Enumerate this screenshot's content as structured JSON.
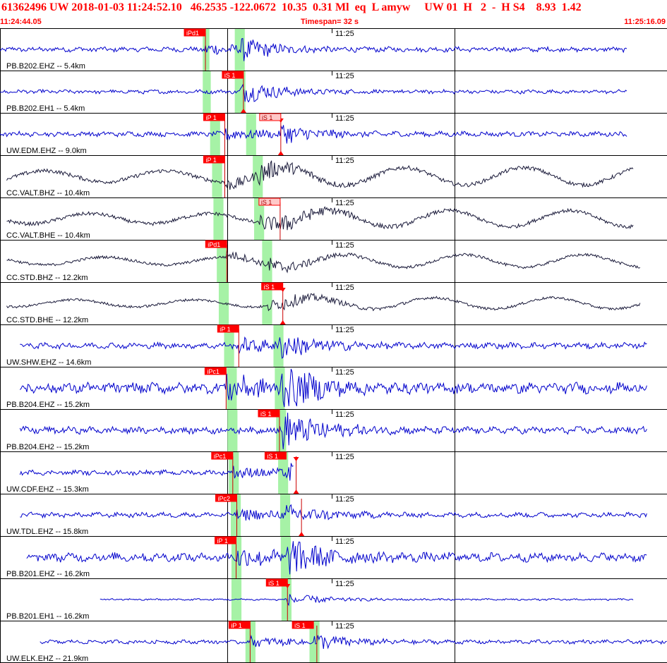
{
  "header": {
    "title": "61362496 UW 2018-01-03 11:24:52.10   46.2535 -122.0672  10.35  0.31 Ml  eq  L amyw     UW 01  H   2  -  H S4    8.93  1.42",
    "start_time": "11:24:44.05",
    "timespan": "Timespan=  32 s",
    "end_time": "11:25:16.09"
  },
  "colors": {
    "header_text": "#ff0000",
    "trace_blue": "#0000cc",
    "trace_black": "#1a1a3a",
    "pick_box": "#ff0000",
    "pick_box_light": "#ffc8c8",
    "pick_line": "#cc0000",
    "window_band": "#a6f2a6",
    "grid": "#000000"
  },
  "minute_label": "11:25",
  "traces": [
    {
      "label": "PB.B202.EHZ -- 5.4km",
      "color": "blue",
      "amp": 5,
      "lowfreq": false,
      "start": 0.0,
      "end": 0.94,
      "picks": [
        {
          "text": "iPd1",
          "pos": 0.308,
          "light": false
        }
      ],
      "bands": [
        {
          "a": 0.304,
          "b": 0.314
        },
        {
          "a": 0.352,
          "b": 0.367
        }
      ],
      "lines": [
        {
          "pos": 0.308,
          "top": false,
          "bottom": false
        }
      ]
    },
    {
      "label": "PB.B202.EH1 -- 5.4km",
      "color": "blue",
      "amp": 4,
      "lowfreq": false,
      "start": 0.0,
      "end": 0.94,
      "picks": [
        {
          "text": "iS 1",
          "pos": 0.365,
          "light": false
        }
      ],
      "bands": [
        {
          "a": 0.304,
          "b": 0.316
        },
        {
          "a": 0.352,
          "b": 0.368
        }
      ],
      "lines": [
        {
          "pos": 0.365,
          "top": false,
          "bottom": true
        }
      ]
    },
    {
      "label": "UW.EDM.EHZ -- 9.0km",
      "color": "blue",
      "amp": 5,
      "lowfreq": false,
      "start": 0.0,
      "end": 0.94,
      "picks": [
        {
          "text": "iP 1",
          "pos": 0.337,
          "light": false
        },
        {
          "text": "iS 1",
          "pos": 0.421,
          "light": true
        }
      ],
      "bands": [
        {
          "a": 0.315,
          "b": 0.33
        },
        {
          "a": 0.369,
          "b": 0.384
        }
      ],
      "lines": [
        {
          "pos": 0.337,
          "top": false,
          "bottom": false
        },
        {
          "pos": 0.421,
          "top": true,
          "bottom": true
        }
      ]
    },
    {
      "label": "CC.VALT.BHZ -- 10.4km",
      "color": "black",
      "amp": 14,
      "lowfreq": true,
      "start": 0.01,
      "end": 0.95,
      "picks": [
        {
          "text": "iP 1",
          "pos": 0.337,
          "light": false
        }
      ],
      "bands": [
        {
          "a": 0.318,
          "b": 0.333
        },
        {
          "a": 0.379,
          "b": 0.394
        }
      ],
      "lines": [
        {
          "pos": 0.337,
          "top": false,
          "bottom": false
        }
      ]
    },
    {
      "label": "CC.VALT.BHE -- 10.4km",
      "color": "black",
      "amp": 13,
      "lowfreq": true,
      "start": 0.01,
      "end": 0.95,
      "picks": [
        {
          "text": "iS 1",
          "pos": 0.42,
          "light": true
        }
      ],
      "bands": [
        {
          "a": 0.32,
          "b": 0.335
        },
        {
          "a": 0.381,
          "b": 0.396
        }
      ],
      "lines": [
        {
          "pos": 0.42,
          "top": false,
          "bottom": false
        }
      ]
    },
    {
      "label": "CC.STD.BHZ -- 12.2km",
      "color": "black",
      "amp": 10,
      "lowfreq": true,
      "start": 0.01,
      "end": 0.96,
      "picks": [
        {
          "text": "iPd1",
          "pos": 0.34,
          "light": false
        }
      ],
      "bands": [
        {
          "a": 0.325,
          "b": 0.34
        },
        {
          "a": 0.393,
          "b": 0.408
        }
      ],
      "lines": [
        {
          "pos": 0.34,
          "top": false,
          "bottom": false
        }
      ]
    },
    {
      "label": "CC.STD.BHE -- 12.2km",
      "color": "black",
      "amp": 9,
      "lowfreq": true,
      "start": 0.01,
      "end": 0.96,
      "picks": [
        {
          "text": "iS 1",
          "pos": 0.424,
          "light": false
        }
      ],
      "bands": [
        {
          "a": 0.328,
          "b": 0.343
        },
        {
          "a": 0.393,
          "b": 0.408
        }
      ],
      "lines": [
        {
          "pos": 0.424,
          "top": true,
          "bottom": true
        }
      ]
    },
    {
      "label": "UW.SHW.EHZ -- 14.6km",
      "color": "blue",
      "amp": 6,
      "lowfreq": false,
      "start": 0.03,
      "end": 0.97,
      "picks": [
        {
          "text": "iP 1",
          "pos": 0.358,
          "light": false
        }
      ],
      "bands": [
        {
          "a": 0.336,
          "b": 0.351
        },
        {
          "a": 0.41,
          "b": 0.425
        }
      ],
      "lines": [
        {
          "pos": 0.358,
          "top": false,
          "bottom": false
        }
      ]
    },
    {
      "label": "PB.B204.EHZ -- 15.2km",
      "color": "blue",
      "amp": 11,
      "lowfreq": false,
      "start": 0.03,
      "end": 0.97,
      "picks": [
        {
          "text": "iPc1",
          "pos": 0.339,
          "light": false
        }
      ],
      "bands": [
        {
          "a": 0.34,
          "b": 0.355
        },
        {
          "a": 0.412,
          "b": 0.427
        }
      ],
      "lines": [
        {
          "pos": 0.339,
          "top": false,
          "bottom": false
        }
      ]
    },
    {
      "label": "PB.B204.EH2 -- 15.2km",
      "color": "blue",
      "amp": 7,
      "lowfreq": false,
      "start": 0.03,
      "end": 0.97,
      "picks": [
        {
          "text": "iS 1",
          "pos": 0.419,
          "light": false
        }
      ],
      "bands": [
        {
          "a": 0.341,
          "b": 0.356
        },
        {
          "a": 0.414,
          "b": 0.429
        }
      ],
      "lines": [
        {
          "pos": 0.419,
          "top": false,
          "bottom": false
        }
      ]
    },
    {
      "label": "UW.CDF.EHZ -- 15.3km",
      "color": "blue",
      "amp": 5,
      "lowfreq": false,
      "start": 0.03,
      "end": 0.44,
      "picks": [
        {
          "text": "iPc1",
          "pos": 0.349,
          "light": false
        },
        {
          "text": "iS 1",
          "pos": 0.429,
          "light": false
        }
      ],
      "bands": [
        {
          "a": 0.343,
          "b": 0.358
        },
        {
          "a": 0.417,
          "b": 0.432
        }
      ],
      "lines": [
        {
          "pos": 0.349,
          "top": false,
          "bottom": false
        },
        {
          "pos": 0.444,
          "top": true,
          "bottom": true
        }
      ]
    },
    {
      "label": "UW.TDL.EHZ -- 15.8km",
      "color": "blue",
      "amp": 5,
      "lowfreq": false,
      "start": 0.03,
      "end": 0.97,
      "picks": [
        {
          "text": "iPc2",
          "pos": 0.355,
          "light": false
        }
      ],
      "bands": [
        {
          "a": 0.346,
          "b": 0.361
        },
        {
          "a": 0.42,
          "b": 0.435
        }
      ],
      "lines": [
        {
          "pos": 0.355,
          "top": false,
          "bottom": false
        },
        {
          "pos": 0.452,
          "top": false,
          "bottom": true
        }
      ]
    },
    {
      "label": "PB.B201.EHZ -- 16.2km",
      "color": "blue",
      "amp": 9,
      "lowfreq": false,
      "start": 0.04,
      "end": 0.97,
      "picks": [
        {
          "text": "iP 1",
          "pos": 0.354,
          "light": false
        }
      ],
      "bands": [
        {
          "a": 0.347,
          "b": 0.362
        },
        {
          "a": 0.421,
          "b": 0.436
        }
      ],
      "lines": [
        {
          "pos": 0.354,
          "top": false,
          "bottom": false
        }
      ]
    },
    {
      "label": "PB.B201.EH1 -- 16.2km",
      "color": "blue",
      "amp": 2,
      "lowfreq": false,
      "start": 0.15,
      "end": 0.95,
      "picks": [
        {
          "text": "iS 1",
          "pos": 0.431,
          "light": false
        }
      ],
      "bands": [
        {
          "a": 0.347,
          "b": 0.362
        },
        {
          "a": 0.422,
          "b": 0.437
        }
      ],
      "lines": [
        {
          "pos": 0.431,
          "top": true,
          "bottom": false
        }
      ]
    },
    {
      "label": "UW.ELK.EHZ -- 21.9km",
      "color": "blue",
      "amp": 4,
      "lowfreq": false,
      "start": 0.06,
      "end": 1.0,
      "picks": [
        {
          "text": "iP 1",
          "pos": 0.375,
          "light": false
        },
        {
          "text": "iS 1",
          "pos": 0.47,
          "light": false
        }
      ],
      "bands": [
        {
          "a": 0.368,
          "b": 0.383
        },
        {
          "a": 0.464,
          "b": 0.479
        }
      ],
      "lines": [
        {
          "pos": 0.375,
          "top": false,
          "bottom": false
        },
        {
          "pos": 0.475,
          "top": false,
          "bottom": false
        }
      ]
    }
  ]
}
